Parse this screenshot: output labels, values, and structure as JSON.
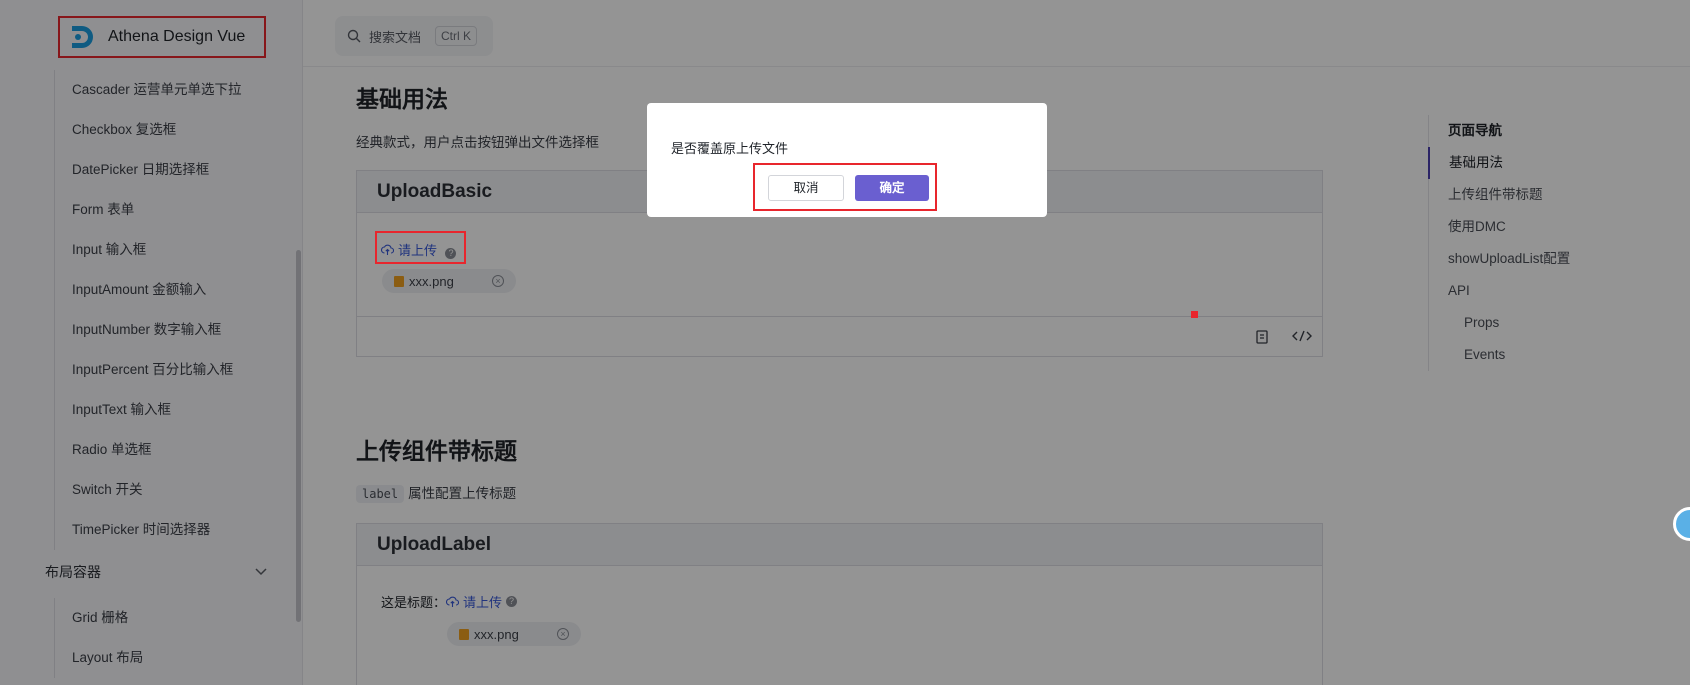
{
  "logo": {
    "text": "Athena Design Vue"
  },
  "search": {
    "placeholder": "搜索文档",
    "shortcut": "Ctrl K"
  },
  "sidebar": {
    "items": [
      "Cascader 运营单元单选下拉",
      "Checkbox 复选框",
      "DatePicker 日期选择框",
      "Form 表单",
      "Input 输入框",
      "InputAmount 金额输入",
      "InputNumber 数字输入框",
      "InputPercent 百分比输入框",
      "InputText 输入框",
      "Radio 单选框",
      "Switch 开关",
      "TimePicker 时间选择器"
    ],
    "group_label": "布局容器",
    "group_items": [
      "Grid 栅格",
      "Layout 布局"
    ]
  },
  "section1": {
    "title": "基础用法",
    "desc": "经典款式，用户点击按钮弹出文件选择框",
    "demo_title": "UploadBasic",
    "upload_label": "请上传",
    "file_name": "xxx.png"
  },
  "section2": {
    "title": "上传组件带标题",
    "code": "label",
    "desc": "属性配置上传标题",
    "demo_title": "UploadLabel",
    "field_label": "这是标题：",
    "upload_label": "请上传",
    "file_name": "xxx.png"
  },
  "toc": {
    "title": "页面导航",
    "items": [
      "基础用法",
      "上传组件带标题",
      "使用DMC",
      "showUploadList配置",
      "API",
      "Props",
      "Events"
    ]
  },
  "modal": {
    "message": "是否覆盖原上传文件",
    "cancel": "取消",
    "ok": "确定"
  },
  "colors": {
    "accent": "#6a5fd0",
    "highlight": "#e8262d",
    "link": "#3a5bd9"
  }
}
